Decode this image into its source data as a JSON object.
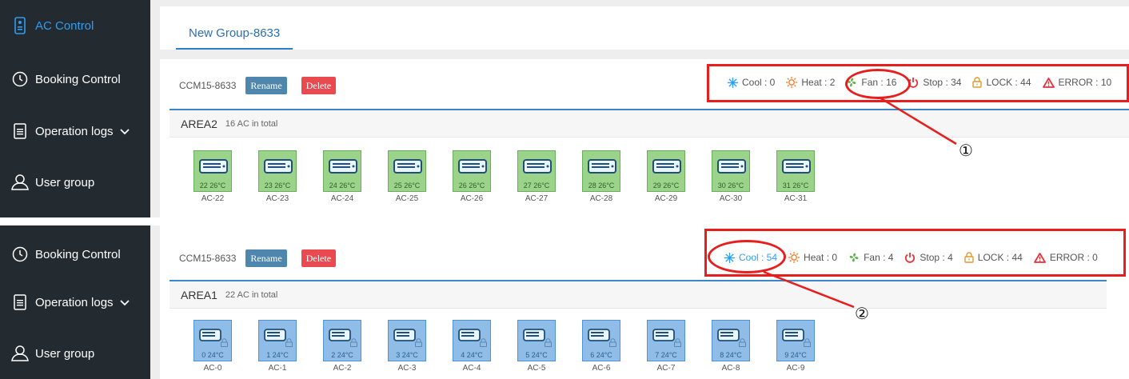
{
  "panel1": {
    "sidebar": {
      "items": [
        {
          "label": "AC Control",
          "icon": "remote-icon",
          "active": true
        },
        {
          "label": "Booking Control",
          "icon": "clock-icon"
        },
        {
          "label": "Operation logs",
          "icon": "document-icon",
          "has_chevron": true
        },
        {
          "label": "User group",
          "icon": "user-icon"
        }
      ]
    },
    "tab": {
      "label": "New Group-8633"
    },
    "group": {
      "name": "CCM15-8633",
      "rename_label": "Rename",
      "delete_label": "Delete"
    },
    "stats": [
      {
        "label": "Cool : 0",
        "icon": "snowflake-icon",
        "color": "#2e9df2"
      },
      {
        "label": "Heat : 2",
        "icon": "sun-icon",
        "color": "#f07c28"
      },
      {
        "label": "Fan : 16",
        "icon": "fan-icon",
        "color": "#5bb44a"
      },
      {
        "label": "Stop : 34",
        "icon": "power-icon",
        "color": "#e8323a"
      },
      {
        "label": "LOCK : 44",
        "icon": "lock-icon",
        "color": "#e09a2a"
      },
      {
        "label": "ERROR : 10",
        "icon": "warning-icon",
        "color": "#e8323a"
      }
    ],
    "area": {
      "name": "AREA2",
      "count": "16 AC in total"
    },
    "units": [
      {
        "value": "22  26°C",
        "label": "AC-22"
      },
      {
        "value": "23  26°C",
        "label": "AC-23"
      },
      {
        "value": "24  26°C",
        "label": "AC-24"
      },
      {
        "value": "25  26°C",
        "label": "AC-25"
      },
      {
        "value": "26  26°C",
        "label": "AC-26"
      },
      {
        "value": "27  26°C",
        "label": "AC-27"
      },
      {
        "value": "28  26°C",
        "label": "AC-28"
      },
      {
        "value": "29  26°C",
        "label": "AC-29"
      },
      {
        "value": "30  26°C",
        "label": "AC-30"
      },
      {
        "value": "31  26°C",
        "label": "AC-31"
      }
    ],
    "callout": "①"
  },
  "panel2": {
    "sidebar": {
      "items": [
        {
          "label": "Booking Control",
          "icon": "clock-icon"
        },
        {
          "label": "Operation logs",
          "icon": "document-icon",
          "has_chevron": true
        },
        {
          "label": "User group",
          "icon": "user-icon"
        }
      ]
    },
    "group": {
      "name": "CCM15-8633",
      "rename_label": "Rename",
      "delete_label": "Delete"
    },
    "stats": [
      {
        "label": "Cool : 54",
        "icon": "snowflake-icon",
        "color": "#2e9df2"
      },
      {
        "label": "Heat : 0",
        "icon": "sun-icon",
        "color": "#f07c28"
      },
      {
        "label": "Fan : 4",
        "icon": "fan-icon",
        "color": "#5bb44a"
      },
      {
        "label": "Stop : 4",
        "icon": "power-icon",
        "color": "#e8323a"
      },
      {
        "label": "LOCK : 44",
        "icon": "lock-icon",
        "color": "#e09a2a"
      },
      {
        "label": "ERROR : 0",
        "icon": "warning-icon",
        "color": "#e8323a"
      }
    ],
    "area": {
      "name": "AREA1",
      "count": "22 AC in total"
    },
    "units": [
      {
        "value": "0  24°C",
        "label": "AC-0"
      },
      {
        "value": "1  24°C",
        "label": "AC-1"
      },
      {
        "value": "2  24°C",
        "label": "AC-2"
      },
      {
        "value": "3  24°C",
        "label": "AC-3"
      },
      {
        "value": "4  24°C",
        "label": "AC-4"
      },
      {
        "value": "5  24°C",
        "label": "AC-5"
      },
      {
        "value": "6  24°C",
        "label": "AC-6"
      },
      {
        "value": "7  24°C",
        "label": "AC-7"
      },
      {
        "value": "8  24°C",
        "label": "AC-8"
      },
      {
        "value": "9  24°C",
        "label": "AC-9"
      }
    ],
    "callout": "②"
  },
  "colors": {
    "sidebar_bg": "#232b31",
    "accent_blue": "#2e9df2",
    "rename_btn": "#4e86ad",
    "delete_btn": "#e84a4f",
    "fan_unit": "#9bd38a",
    "cool_unit": "#8fbde8",
    "annotation_red": "#e81d1d"
  }
}
